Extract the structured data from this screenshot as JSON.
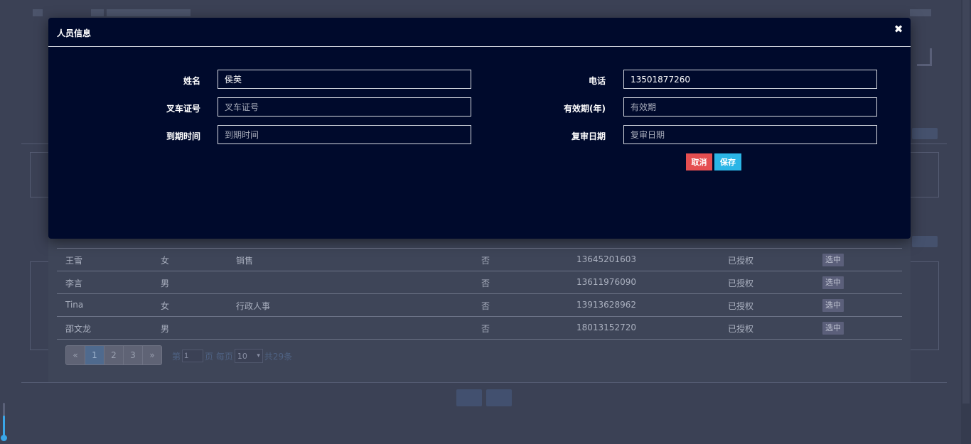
{
  "modal": {
    "title": "人员信息",
    "close_glyph": "✖",
    "fields": {
      "name": {
        "label": "姓名",
        "value": "侯英",
        "placeholder": ""
      },
      "phone": {
        "label": "电话",
        "value": "13501877260",
        "placeholder": ""
      },
      "license_no": {
        "label": "叉车证号",
        "value": "",
        "placeholder": "叉车证号"
      },
      "validity": {
        "label": "有效期(年)",
        "value": "",
        "placeholder": "有效期"
      },
      "expiry": {
        "label": "到期时间",
        "value": "",
        "placeholder": "到期时间"
      },
      "review_date": {
        "label": "复审日期",
        "value": "",
        "placeholder": "复审日期"
      }
    },
    "cancel_label": "取消",
    "save_label": "保存"
  },
  "people_table": {
    "rows": [
      {
        "name": "王雪",
        "gender": "女",
        "dept": "销售",
        "flag": "否",
        "phone": "13645201603",
        "status": "已授权",
        "action": "选中"
      },
      {
        "name": "李言",
        "gender": "男",
        "dept": "",
        "flag": "否",
        "phone": "13611976090",
        "status": "已授权",
        "action": "选中"
      },
      {
        "name": "Tina",
        "gender": "女",
        "dept": "行政人事",
        "flag": "否",
        "phone": "13913628962",
        "status": "已授权",
        "action": "选中"
      },
      {
        "name": "邵文龙",
        "gender": "男",
        "dept": "",
        "flag": "否",
        "phone": "18013152720",
        "status": "已授权",
        "action": "选中"
      }
    ]
  },
  "pagination": {
    "prev": "«",
    "pages": [
      "1",
      "2",
      "3"
    ],
    "active_page": "1",
    "next": "»",
    "page_prefix": "第",
    "current_page": "1",
    "page_suffix": "页 每页",
    "page_size": "10",
    "total": "共29条"
  },
  "slider": {
    "level": 0.64
  },
  "colors": {
    "modal_bg": "#000a2c",
    "cancel": "#e54e50",
    "save": "#2bb5e6",
    "page_bg": "#3b4155"
  },
  "icons": {
    "close": "close-icon",
    "select_caret": "chevron-down-icon"
  }
}
